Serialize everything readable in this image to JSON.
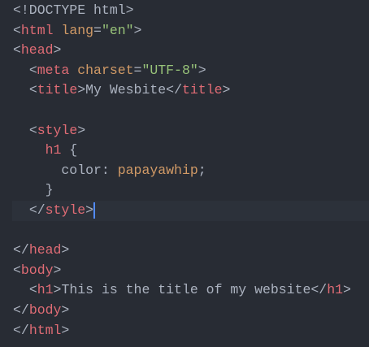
{
  "editor": {
    "colors": {
      "background": "#282c34",
      "current_line": "#2c313a",
      "cursor": "#528bff",
      "tag": "#e06c75",
      "attribute": "#d19a66",
      "string": "#98c379",
      "text": "#abb2bf"
    },
    "cursor_line": 10,
    "lines": [
      [
        [
          "p",
          "<!DOCTYPE html>"
        ]
      ],
      [
        [
          "p",
          "<"
        ],
        [
          "t",
          "html"
        ],
        [
          "x",
          " "
        ],
        [
          "a",
          "lang"
        ],
        [
          "p",
          "="
        ],
        [
          "s",
          "\"en\""
        ],
        [
          "p",
          ">"
        ]
      ],
      [
        [
          "p",
          "<"
        ],
        [
          "t",
          "head"
        ],
        [
          "p",
          ">"
        ]
      ],
      [
        [
          "x",
          "  "
        ],
        [
          "p",
          "<"
        ],
        [
          "t",
          "meta"
        ],
        [
          "x",
          " "
        ],
        [
          "a",
          "charset"
        ],
        [
          "p",
          "="
        ],
        [
          "s",
          "\"UTF-8\""
        ],
        [
          "p",
          ">"
        ]
      ],
      [
        [
          "x",
          "  "
        ],
        [
          "p",
          "<"
        ],
        [
          "t",
          "title"
        ],
        [
          "p",
          ">"
        ],
        [
          "x",
          "My Wesbite"
        ],
        [
          "p",
          "</"
        ],
        [
          "t",
          "title"
        ],
        [
          "p",
          ">"
        ]
      ],
      [],
      [
        [
          "x",
          "  "
        ],
        [
          "p",
          "<"
        ],
        [
          "t",
          "style"
        ],
        [
          "p",
          ">"
        ]
      ],
      [
        [
          "x",
          "    "
        ],
        [
          "t",
          "h1"
        ],
        [
          "x",
          " {"
        ]
      ],
      [
        [
          "x",
          "      color: "
        ],
        [
          "v",
          "papayawhip"
        ],
        [
          "x",
          ";"
        ]
      ],
      [
        [
          "x",
          "    }"
        ]
      ],
      [
        [
          "x",
          "  "
        ],
        [
          "p",
          "</"
        ],
        [
          "t",
          "style"
        ],
        [
          "p",
          ">"
        ]
      ],
      [],
      [
        [
          "p",
          "</"
        ],
        [
          "t",
          "head"
        ],
        [
          "p",
          ">"
        ]
      ],
      [
        [
          "p",
          "<"
        ],
        [
          "t",
          "body"
        ],
        [
          "p",
          ">"
        ]
      ],
      [
        [
          "x",
          "  "
        ],
        [
          "p",
          "<"
        ],
        [
          "t",
          "h1"
        ],
        [
          "p",
          ">"
        ],
        [
          "x",
          "This is the title of my website"
        ],
        [
          "p",
          "</"
        ],
        [
          "t",
          "h1"
        ],
        [
          "p",
          ">"
        ]
      ],
      [
        [
          "p",
          "</"
        ],
        [
          "t",
          "body"
        ],
        [
          "p",
          ">"
        ]
      ],
      [
        [
          "p",
          "</"
        ],
        [
          "t",
          "html"
        ],
        [
          "p",
          ">"
        ]
      ]
    ]
  }
}
